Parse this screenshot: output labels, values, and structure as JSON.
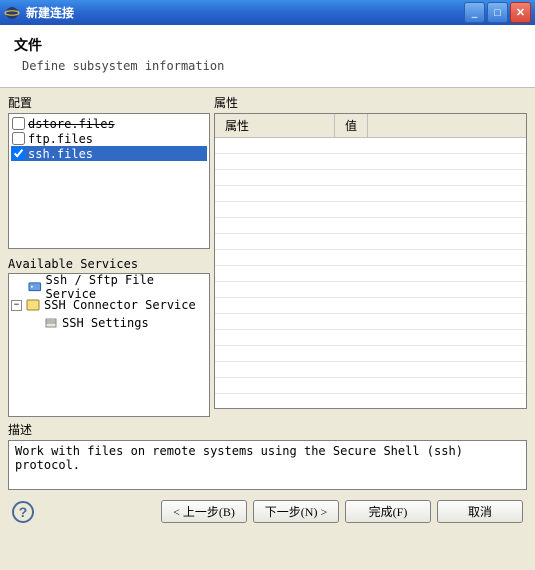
{
  "titlebar": {
    "title": "新建连接"
  },
  "header": {
    "title": "文件",
    "subtitle": "Define subsystem information"
  },
  "config": {
    "label": "配置",
    "items": [
      {
        "id": "dstore.files",
        "label": "dstore.files",
        "checked": false,
        "strike": true
      },
      {
        "id": "ftp.files",
        "label": "ftp.files",
        "checked": false
      },
      {
        "id": "ssh.files",
        "label": "ssh.files",
        "checked": true,
        "selected": true
      }
    ]
  },
  "services": {
    "label": "Available Services",
    "items": {
      "ssh_sftp": "Ssh / Sftp File Service",
      "connector": "SSH Connector Service",
      "settings": "SSH Settings"
    }
  },
  "properties": {
    "label": "属性",
    "col1": "属性",
    "col2": "值"
  },
  "description": {
    "label": "描述",
    "text": "Work with files on remote systems using the Secure Shell (ssh) protocol."
  },
  "buttons": {
    "back": "< 上一步(B)",
    "next": "下一步(N) >",
    "finish": "完成(F)",
    "cancel": "取消"
  }
}
